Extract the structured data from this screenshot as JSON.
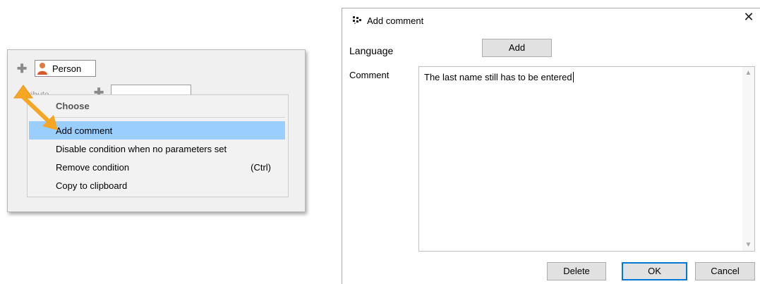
{
  "left": {
    "entity_label": "Person",
    "attribute_label": "Attribute",
    "context_menu": {
      "header": "Choose",
      "items": [
        {
          "label": "Add comment",
          "shortcut": "",
          "highlighted": true
        },
        {
          "label": "Disable condition when no parameters set",
          "shortcut": "",
          "highlighted": false
        },
        {
          "label": "Remove condition",
          "shortcut": "(Ctrl)",
          "highlighted": false
        },
        {
          "label": "Copy to clipboard",
          "shortcut": "",
          "highlighted": false
        }
      ]
    },
    "colors": {
      "highlight": "#99ceff",
      "arrow": "#f5a623"
    }
  },
  "dialog": {
    "title": "Add comment",
    "close_glyph": "✕",
    "language_label": "Language",
    "add_button": "Add",
    "comment_label": "Comment",
    "comment_value": "The last name still has to be entered",
    "buttons": {
      "delete": "Delete",
      "ok": "OK",
      "cancel": "Cancel"
    },
    "colors": {
      "default_button_border": "#0078d7"
    }
  }
}
